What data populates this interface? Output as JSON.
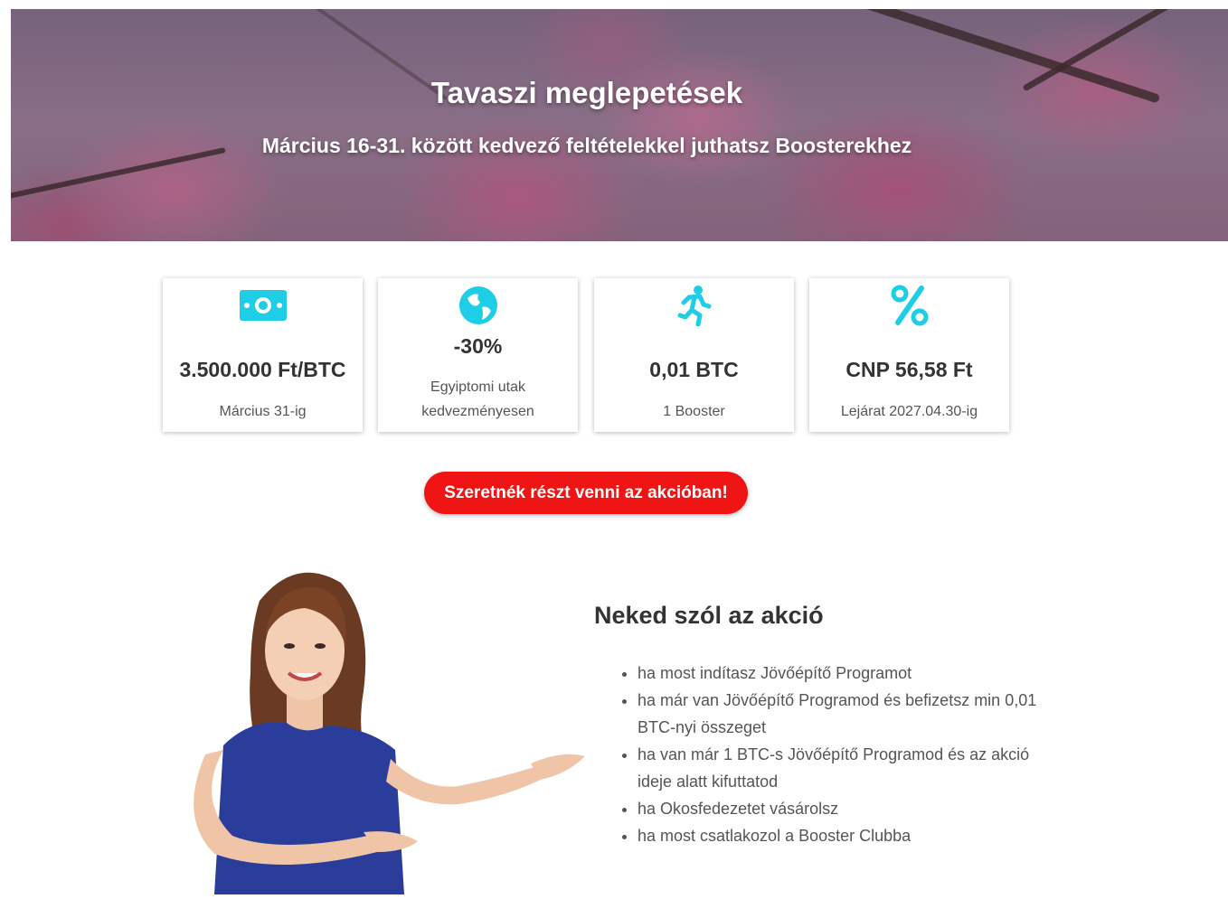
{
  "hero": {
    "title": "Tavaszi meglepetések",
    "subtitle": "Március 16-31. között kedvező feltételekkel juthatsz Boosterekhez"
  },
  "cards": [
    {
      "icon": "money-icon",
      "value": "3.500.000 Ft/BTC",
      "desc": "Március 31-ig"
    },
    {
      "icon": "globe-icon",
      "value": "-30%",
      "desc": "Egyiptomi utak kedvezményesen"
    },
    {
      "icon": "running-person-icon",
      "value": "0,01 BTC",
      "desc": "1 Booster"
    },
    {
      "icon": "percent-icon",
      "value": "CNP 56,58 Ft",
      "desc": "Lejárat 2027.04.30-ig"
    }
  ],
  "cta": {
    "label": "Szeretnék részt venni az akcióban!"
  },
  "offer": {
    "title": "Neked szól az akció",
    "items": [
      "ha most indítasz Jövőépítő Programot",
      "ha már van Jövőépítő Programod és befizetsz min 0,01 BTC-nyi összeget",
      "ha van már 1 BTC-s Jövőépítő Programod és az akció ideje alatt kifuttatod",
      "ha Okosfedezetet vásárolsz",
      "ha most csatlakozol a Booster Clubba"
    ]
  },
  "colors": {
    "accent": "#1ecde6",
    "cta": "#f01414",
    "text": "#333333"
  }
}
